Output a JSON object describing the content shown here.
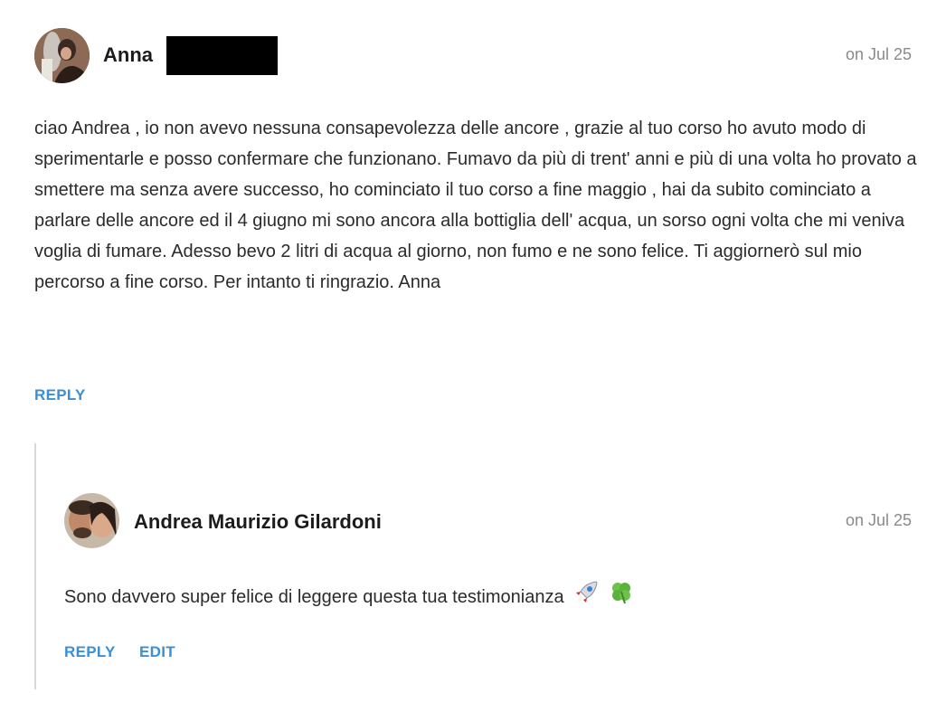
{
  "comments": [
    {
      "author": "Anna",
      "date": "on Jul 25",
      "text": "ciao Andrea , io non avevo nessuna consapevolezza delle ancore , grazie al tuo corso ho avuto modo di sperimentarle e posso confermare che funzionano. Fumavo da più di trent' anni e più di una volta ho provato a smettere ma senza avere successo, ho cominciato il tuo corso a fine maggio , hai da subito cominciato a parlare delle ancore ed il 4 giugno mi sono ancora alla bottiglia dell' acqua, un sorso ogni volta che mi veniva voglia di fumare. Adesso bevo 2 litri di acqua al giorno, non fumo e ne sono felice. Ti aggiornerò sul mio percorso a fine corso. Per intanto ti ringrazio. Anna",
      "reply_label": "REPLY"
    }
  ],
  "replies": [
    {
      "author": "Andrea Maurizio Gilardoni",
      "date": "on Jul 25",
      "text": "Sono davvero super felice di leggere questa tua testimonianza",
      "emojis": [
        "rocket-icon",
        "four-leaf-clover-icon"
      ],
      "reply_label": "REPLY",
      "edit_label": "EDIT"
    }
  ],
  "colors": {
    "action": "#3a8fd6",
    "date": "#8a8a8a",
    "thread_line": "#d9d9d9"
  }
}
